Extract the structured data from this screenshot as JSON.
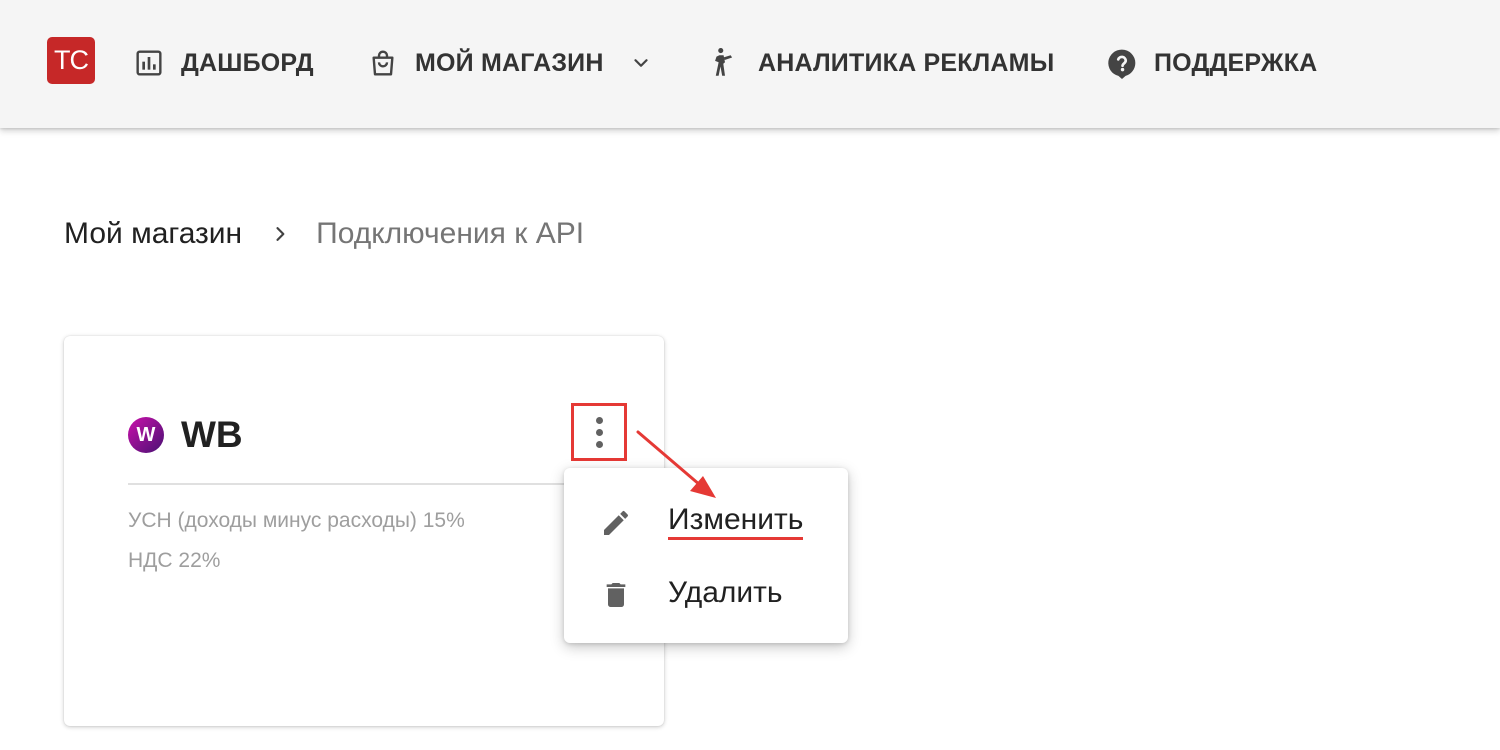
{
  "header": {
    "logo_text": "TC",
    "nav": {
      "dashboard": "ДАШБОРД",
      "shop": "МОЙ МАГАЗИН",
      "ads": "АНАЛИТИКА РЕКЛАМЫ",
      "support": "ПОДДЕРЖКА"
    }
  },
  "breadcrumb": {
    "root": "Мой магазин",
    "current": "Подключения к API"
  },
  "card": {
    "marketplace_icon_letter": "W",
    "title": "WB",
    "tax_line": "УСН (доходы минус расходы) 15%",
    "vat_line": "НДС 22%"
  },
  "menu": {
    "edit_label": "Изменить",
    "delete_label": "Удалить"
  },
  "colors": {
    "logo": "#c62828",
    "highlight": "#e53935",
    "marketplace_gradient_start": "#cb11ab",
    "marketplace_gradient_end": "#481173"
  },
  "icons": {
    "dashboard": "bar-chart-icon",
    "shop": "shopping-bag-icon",
    "ads": "walking-person-icon",
    "support": "help-circle-icon",
    "edit": "pencil-icon",
    "delete": "trash-icon"
  }
}
